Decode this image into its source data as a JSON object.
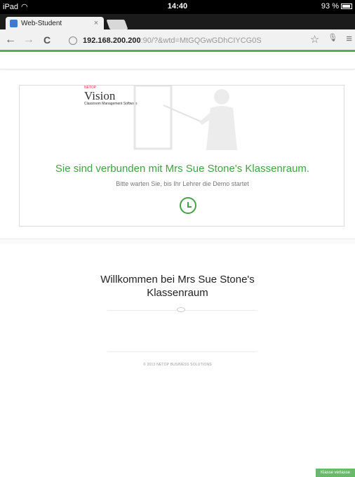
{
  "status_bar": {
    "device": "iPad",
    "time": "14:40",
    "battery": "93 %"
  },
  "tab": {
    "title": "Web-Student",
    "close": "×"
  },
  "toolbar": {
    "back": "←",
    "forward": "→",
    "reload": "C",
    "url_host": "192.168.200.200",
    "url_path": ":90/?&wtd=MtGQGwGDhCIYCG0S",
    "bookmark": "☆",
    "mic": "🎙",
    "menu": "≡"
  },
  "logo": {
    "brand_small": "NETOP",
    "product": "Vision",
    "tagline": "Classroom Management Software"
  },
  "main": {
    "connected_message": "Sie sind verbunden mit Mrs Sue Stone's Klassenraum.",
    "wait_message": "Bitte warten Sie, bis Ihr Lehrer die Demo startet"
  },
  "footer": {
    "welcome_line1": "Willkommen bei Mrs Sue Stone's",
    "welcome_line2": "Klassenraum",
    "copyright": "© 2013 NETOP BUSINESS SOLUTIONS"
  },
  "actions": {
    "leave_class": "Klasse verlasse"
  },
  "colors": {
    "accent_green": "#3fa442",
    "toolbar_stripe": "#4caf50"
  }
}
